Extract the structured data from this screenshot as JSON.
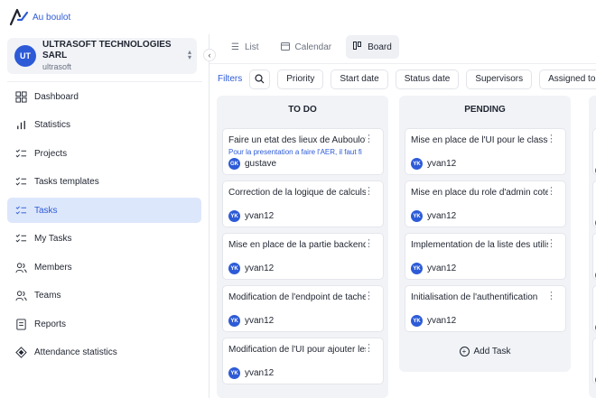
{
  "brand": {
    "name": "Au boulot"
  },
  "org": {
    "initials": "UT",
    "name": "ULTRASOFT TECHNOLOGIES SARL",
    "slug": "ultrasoft"
  },
  "nav": [
    {
      "label": "Dashboard",
      "icon": "dashboard-icon"
    },
    {
      "label": "Statistics",
      "icon": "bar-chart-icon"
    },
    {
      "label": "Projects",
      "icon": "list-check-icon"
    },
    {
      "label": "Tasks templates",
      "icon": "list-check-icon"
    },
    {
      "label": "Tasks",
      "icon": "list-check-icon",
      "active": true
    },
    {
      "label": "My Tasks",
      "icon": "list-check-icon"
    },
    {
      "label": "Members",
      "icon": "users-icon"
    },
    {
      "label": "Teams",
      "icon": "users-icon"
    },
    {
      "label": "Reports",
      "icon": "report-icon"
    },
    {
      "label": "Attendance statistics",
      "icon": "diamond-icon"
    }
  ],
  "tabs": [
    {
      "label": "List",
      "icon": "list-icon"
    },
    {
      "label": "Calendar",
      "icon": "calendar-icon"
    },
    {
      "label": "Board",
      "icon": "board-icon",
      "active": true
    }
  ],
  "filters": {
    "label": "Filters",
    "buttons": [
      "Priority",
      "Start date",
      "Status date",
      "Supervisors",
      "Assigned to"
    ]
  },
  "board": {
    "columns": [
      {
        "title": "TO DO",
        "cards": [
          {
            "title": "Faire un etat des lieux de Auboulot",
            "subtitle": "Pour la presentation a faire l'AER, il faut fi",
            "user_initials": "GK",
            "user": "gustave"
          },
          {
            "title": "Correction de la logique de calculs",
            "subtitle": "",
            "user_initials": "YK",
            "user": "yvan12"
          },
          {
            "title": "Mise en place de la partie backend",
            "subtitle": "",
            "user_initials": "YK",
            "user": "yvan12"
          },
          {
            "title": "Modification de l'endpoint de tache",
            "subtitle": "",
            "user_initials": "YK",
            "user": "yvan12"
          },
          {
            "title": "Modification de l'UI pour ajouter les",
            "subtitle": "",
            "user_initials": "YK",
            "user": "yvan12"
          }
        ]
      },
      {
        "title": "PENDING",
        "cards": [
          {
            "title": "Mise en place de l'UI pour le classe",
            "subtitle": "",
            "user_initials": "YK",
            "user": "yvan12"
          },
          {
            "title": "Mise en place du role d'admin cote",
            "subtitle": "",
            "user_initials": "YK",
            "user": "yvan12"
          },
          {
            "title": "Implementation de la liste des utilis",
            "subtitle": "",
            "user_initials": "YK",
            "user": "yvan12"
          },
          {
            "title": "Initialisation de l'authentification",
            "subtitle": "",
            "user_initials": "YK",
            "user": "yvan12"
          }
        ],
        "add_label": "Add Task"
      }
    ],
    "peek_letters": [
      "A",
      "c",
      "C",
      "A",
      "P"
    ]
  },
  "colors": {
    "accent": "#2d5bd7",
    "active_bg": "#dde7fb",
    "column_bg": "#f1f3f7"
  }
}
